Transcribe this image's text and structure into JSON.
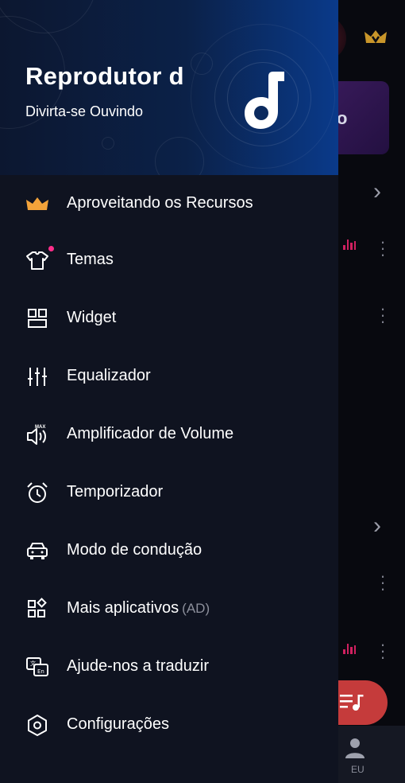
{
  "drawer": {
    "title": "Reprodutor d",
    "subtitle": "Divirta-se Ouvindo",
    "items": [
      {
        "label": "Aproveitando os Recursos",
        "icon": "crown-icon"
      },
      {
        "label": "Temas",
        "icon": "tshirt-icon",
        "badge": true
      },
      {
        "label": "Widget",
        "icon": "widget-icon"
      },
      {
        "label": "Equalizador",
        "icon": "equalizer-icon"
      },
      {
        "label": "Amplificador de Volume",
        "icon": "volume-max-icon"
      },
      {
        "label": "Temporizador",
        "icon": "alarm-clock-icon"
      },
      {
        "label": "Modo de condução",
        "icon": "car-icon"
      },
      {
        "label": "Mais aplicativos",
        "suffix": "(AD)",
        "icon": "apps-icon"
      },
      {
        "label": "Ajude-nos a traduzir",
        "icon": "translate-icon"
      },
      {
        "label": "Configurações",
        "icon": "settings-hex-icon"
      }
    ]
  },
  "background": {
    "card_text": "o",
    "bottom_tab_label": "EU",
    "volume_icon_text": "MAX"
  },
  "colors": {
    "drawer_bg": "#0f1320",
    "header_gradient_end": "#0a3a8a",
    "crown": "#f3a33a",
    "badge": "#ff2e8a",
    "fab": "#c53b3b"
  }
}
